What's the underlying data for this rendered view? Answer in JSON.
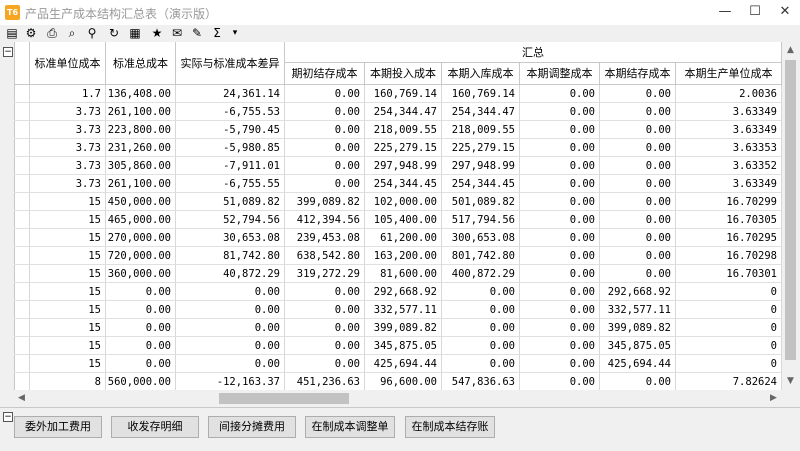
{
  "window": {
    "app_icon_text": "T6",
    "title": "产品生产成本结构汇总表（演示版）",
    "min_glyph": "—",
    "max_glyph": "☐",
    "close_glyph": "✕"
  },
  "toolbar": {
    "icons": [
      "print-preview-icon",
      "export-icon",
      "print-icon",
      "find-icon",
      "binoculars-icon",
      "refresh-icon",
      "excel-icon",
      "favorite-icon",
      "mail-icon",
      "comment-icon",
      "sum-icon"
    ],
    "glyphs": [
      "▤",
      "⚙",
      "⎙",
      "⌕",
      "⚲",
      "↻",
      "▦",
      "★",
      "✉",
      "✎",
      "Σ"
    ],
    "dropdown": "▾"
  },
  "grid": {
    "collapse_glyph": "−",
    "group_header": "汇总",
    "columns": [
      "",
      "标准单位成本",
      "标准总成本",
      "实际与标准成本差异",
      "期初结存成本",
      "本期投入成本",
      "本期入库成本",
      "本期调整成本",
      "本期结存成本",
      "本期生产单位成本"
    ],
    "rows": [
      [
        "",
        "1.7",
        "136,408.00",
        "24,361.14",
        "0.00",
        "160,769.14",
        "160,769.14",
        "0.00",
        "0.00",
        "2.0036"
      ],
      [
        "",
        "3.73",
        "261,100.00",
        "-6,755.53",
        "0.00",
        "254,344.47",
        "254,344.47",
        "0.00",
        "0.00",
        "3.63349"
      ],
      [
        "",
        "3.73",
        "223,800.00",
        "-5,790.45",
        "0.00",
        "218,009.55",
        "218,009.55",
        "0.00",
        "0.00",
        "3.63349"
      ],
      [
        "",
        "3.73",
        "231,260.00",
        "-5,980.85",
        "0.00",
        "225,279.15",
        "225,279.15",
        "0.00",
        "0.00",
        "3.63353"
      ],
      [
        "",
        "3.73",
        "305,860.00",
        "-7,911.01",
        "0.00",
        "297,948.99",
        "297,948.99",
        "0.00",
        "0.00",
        "3.63352"
      ],
      [
        "",
        "3.73",
        "261,100.00",
        "-6,755.55",
        "0.00",
        "254,344.45",
        "254,344.45",
        "0.00",
        "0.00",
        "3.63349"
      ],
      [
        "",
        "15",
        "450,000.00",
        "51,089.82",
        "399,089.82",
        "102,000.00",
        "501,089.82",
        "0.00",
        "0.00",
        "16.70299"
      ],
      [
        "",
        "15",
        "465,000.00",
        "52,794.56",
        "412,394.56",
        "105,400.00",
        "517,794.56",
        "0.00",
        "0.00",
        "16.70305"
      ],
      [
        "",
        "15",
        "270,000.00",
        "30,653.08",
        "239,453.08",
        "61,200.00",
        "300,653.08",
        "0.00",
        "0.00",
        "16.70295"
      ],
      [
        "",
        "15",
        "720,000.00",
        "81,742.80",
        "638,542.80",
        "163,200.00",
        "801,742.80",
        "0.00",
        "0.00",
        "16.70298"
      ],
      [
        "",
        "15",
        "360,000.00",
        "40,872.29",
        "319,272.29",
        "81,600.00",
        "400,872.29",
        "0.00",
        "0.00",
        "16.70301"
      ],
      [
        "",
        "15",
        "0.00",
        "0.00",
        "0.00",
        "292,668.92",
        "0.00",
        "0.00",
        "292,668.92",
        "0"
      ],
      [
        "",
        "15",
        "0.00",
        "0.00",
        "0.00",
        "332,577.11",
        "0.00",
        "0.00",
        "332,577.11",
        "0"
      ],
      [
        "",
        "15",
        "0.00",
        "0.00",
        "0.00",
        "399,089.82",
        "0.00",
        "0.00",
        "399,089.82",
        "0"
      ],
      [
        "",
        "15",
        "0.00",
        "0.00",
        "0.00",
        "345,875.05",
        "0.00",
        "0.00",
        "345,875.05",
        "0"
      ],
      [
        "",
        "15",
        "0.00",
        "0.00",
        "0.00",
        "425,694.44",
        "0.00",
        "0.00",
        "425,694.44",
        "0"
      ],
      [
        "",
        "8",
        "560,000.00",
        "-12,163.37",
        "451,236.63",
        "96,600.00",
        "547,836.63",
        "0.00",
        "0.00",
        "7.82624"
      ]
    ]
  },
  "scroll": {
    "up": "▲",
    "down": "▼",
    "left": "◀",
    "right": "▶"
  },
  "buttons": [
    "委外加工费用",
    "收发存明细",
    "间接分摊费用",
    "在制成本调整单",
    "在制成本结存账"
  ]
}
